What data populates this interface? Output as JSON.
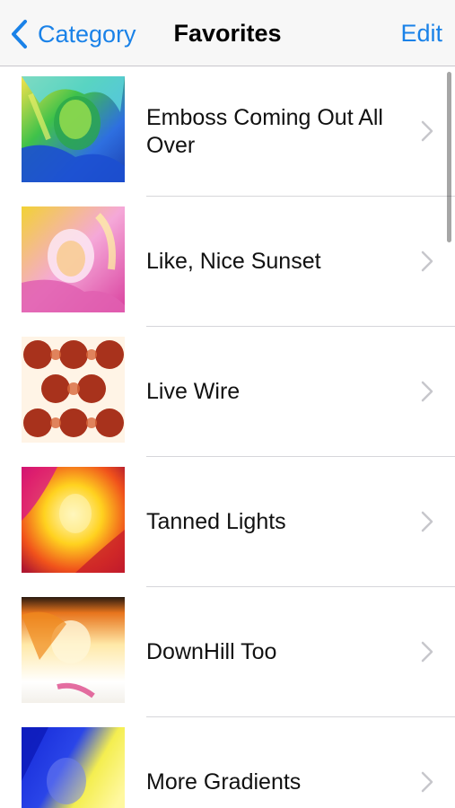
{
  "navbar": {
    "back_label": "Category",
    "title": "Favorites",
    "edit_label": "Edit"
  },
  "colors": {
    "accent": "#1a82e8",
    "separator": "#d6d6da",
    "navbar_bg": "#f7f7f7"
  },
  "rows": [
    {
      "title": "Emboss Coming Out All Over",
      "thumb_style": "emboss-rainbow"
    },
    {
      "title": "Like, Nice Sunset",
      "thumb_style": "pink-yellow-sunset"
    },
    {
      "title": "Live Wire",
      "thumb_style": "red-lattice"
    },
    {
      "title": "Tanned Lights",
      "thumb_style": "yellow-red-glow"
    },
    {
      "title": "DownHill Too",
      "thumb_style": "orange-white-blur"
    },
    {
      "title": "More Gradients",
      "thumb_style": "blue-yellow-gradient"
    }
  ]
}
